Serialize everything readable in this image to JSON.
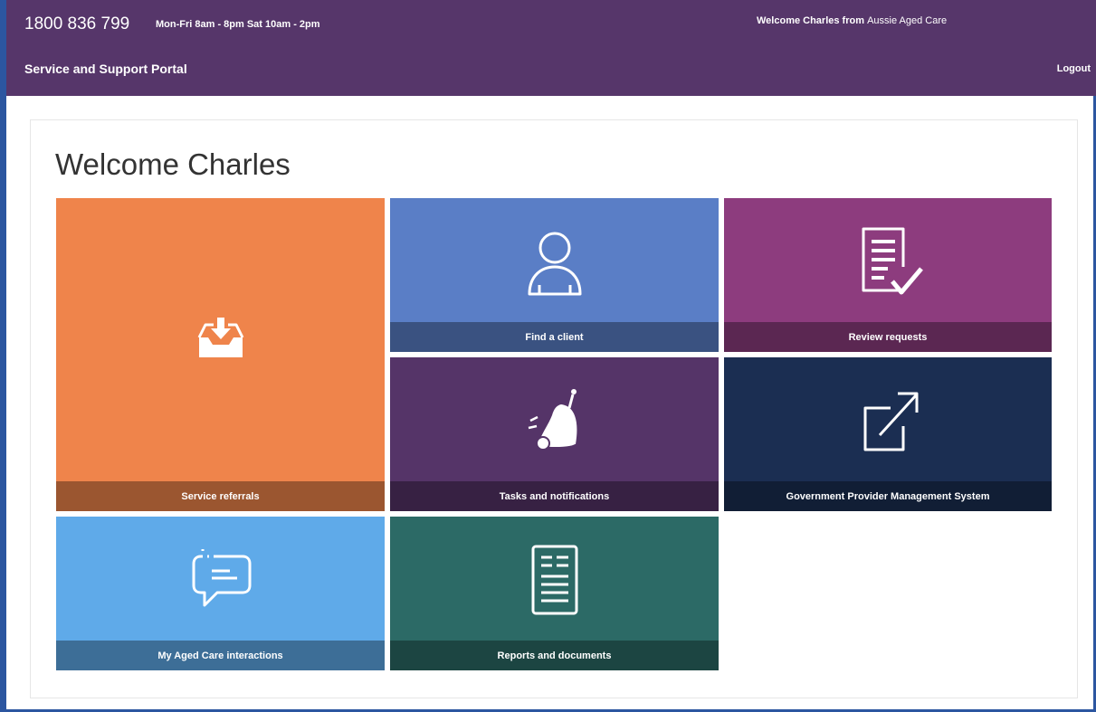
{
  "header": {
    "phone": "1800 836 799",
    "hours": "Mon-Fri 8am - 8pm Sat 10am - 2pm",
    "welcome_prefix": "Welcome Charles from",
    "organisation": "Aussie Aged Care",
    "portal_title": "Service and Support Portal",
    "logout_label": "Logout"
  },
  "main": {
    "title": "Welcome Charles"
  },
  "tiles": [
    {
      "label": "Service referrals",
      "icon": "inbox-download-icon",
      "color": "#ef844b"
    },
    {
      "label": "Find a client",
      "icon": "person-icon",
      "color": "#5a7ec6"
    },
    {
      "label": "Review requests",
      "icon": "document-check-icon",
      "color": "#8d3c7e"
    },
    {
      "label": "Tasks and notifications",
      "icon": "bell-icon",
      "color": "#553468"
    },
    {
      "label": "Government Provider Management System",
      "icon": "external-link-icon",
      "color": "#1b2e52"
    },
    {
      "label": "My Aged Care interactions",
      "icon": "chat-bubble-icon",
      "color": "#5faae9"
    },
    {
      "label": "Reports and documents",
      "icon": "report-document-icon",
      "color": "#2c6a66"
    }
  ],
  "colors": {
    "header_bg": "#56366a",
    "frame_border": "#2c56a0"
  }
}
